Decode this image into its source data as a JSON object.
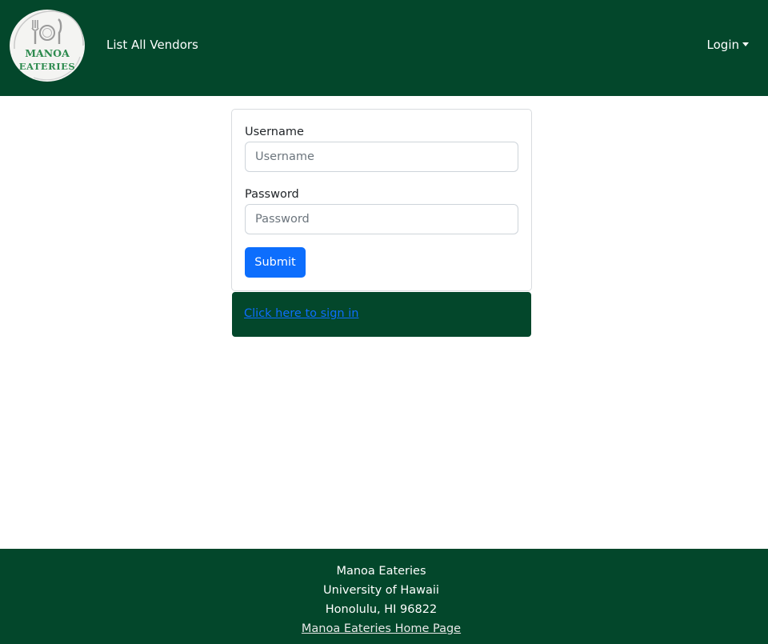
{
  "navbar": {
    "logo": {
      "icon": "fork-plate-knife-icon",
      "line1": "MANOA",
      "line2": "EATERIES",
      "text_color": "#2e8b4f"
    },
    "links": [
      {
        "label": "List All Vendors"
      }
    ],
    "login_label": "Login",
    "background": "#03472b"
  },
  "signin_form": {
    "username_label": "Username",
    "username_placeholder": "Username",
    "username_value": "",
    "password_label": "Password",
    "password_placeholder": "Password",
    "password_value": "",
    "submit_label": "Submit",
    "submit_color": "#0d6efd"
  },
  "signin_link_box": {
    "link_text": "Click here to sign in"
  },
  "footer": {
    "line1": "Manoa Eateries",
    "line2": "University of Hawaii",
    "line3": "Honolulu, HI 96822",
    "link_text": "Manoa Eateries Home Page"
  }
}
